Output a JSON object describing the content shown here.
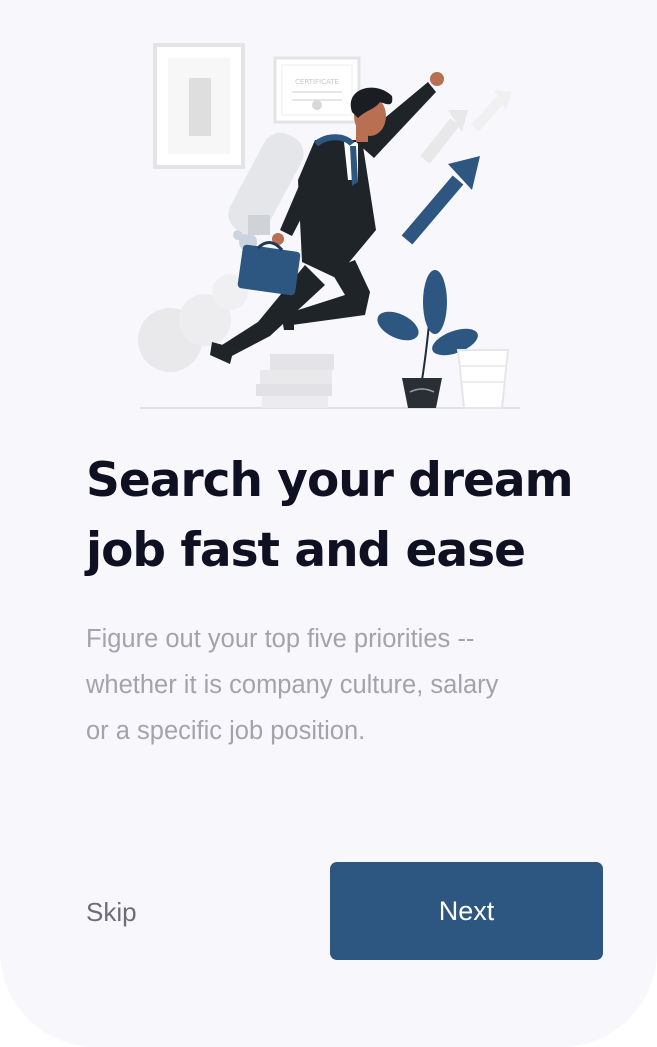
{
  "onboarding": {
    "title_line1": "Search your dream",
    "title_line2": "job fast and ease",
    "description_line1": "Figure out your top five priorities --",
    "description_line2": "whether it is company culture, salary",
    "description_line3": "or a specific job position.",
    "illustration_certificate_text": "CERTIFICATE"
  },
  "actions": {
    "skip_label": "Skip",
    "next_label": "Next"
  },
  "colors": {
    "accent": "#2d5680",
    "title": "#0f1022",
    "description": "#a3a3ab",
    "background": "#f8f8fc"
  }
}
